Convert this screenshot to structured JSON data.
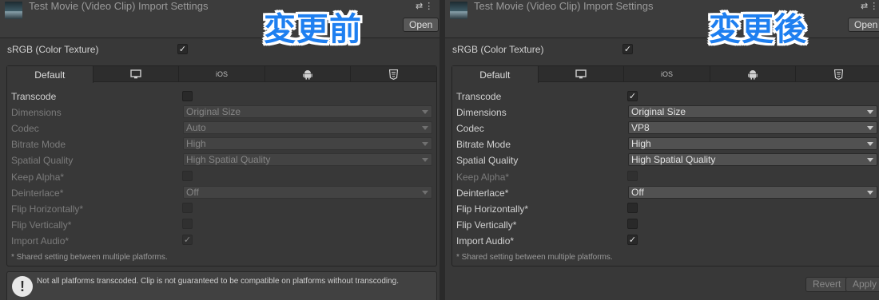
{
  "colors": {
    "stamp_blue": "#1e7ff0",
    "background": "#383838",
    "tab_bar": "#2d2d2d"
  },
  "left": {
    "window_title": "Test Movie (Video Clip) Import Settings",
    "stamp": "変更前",
    "open_label": "Open",
    "srgb_label": "sRGB (Color Texture)",
    "srgb_checked": true,
    "tabs": [
      {
        "label": "Default",
        "icon": ""
      },
      {
        "label": "",
        "icon": "monitor-icon"
      },
      {
        "label": "iOS",
        "icon": ""
      },
      {
        "label": "",
        "icon": "android-icon"
      },
      {
        "label": "",
        "icon": "html5-icon"
      }
    ],
    "rows": [
      {
        "label": "Transcode",
        "type": "check",
        "checked": false,
        "enabled": true
      },
      {
        "label": "Dimensions",
        "type": "dropdown",
        "value": "Original Size",
        "enabled": false
      },
      {
        "label": "Codec",
        "type": "dropdown",
        "value": "Auto",
        "enabled": false
      },
      {
        "label": "Bitrate Mode",
        "type": "dropdown",
        "value": "High",
        "enabled": false
      },
      {
        "label": "Spatial Quality",
        "type": "dropdown",
        "value": "High Spatial Quality",
        "enabled": false
      },
      {
        "label": "Keep Alpha*",
        "type": "check",
        "checked": false,
        "enabled": false
      },
      {
        "label": "Deinterlace*",
        "type": "dropdown",
        "value": "Off",
        "enabled": false
      },
      {
        "label": "Flip Horizontally*",
        "type": "check",
        "checked": false,
        "enabled": false
      },
      {
        "label": "Flip Vertically*",
        "type": "check",
        "checked": false,
        "enabled": false
      },
      {
        "label": "Import Audio*",
        "type": "check",
        "checked": true,
        "enabled": false
      }
    ],
    "footnote": "* Shared setting between multiple platforms.",
    "warning": "Not all platforms transcoded. Clip is not guaranteed to be compatible on platforms without transcoding."
  },
  "right": {
    "window_title": "Test Movie (Video Clip) Import Settings",
    "stamp": "変更後",
    "open_label": "Open",
    "srgb_label": "sRGB (Color Texture)",
    "srgb_checked": true,
    "tabs": [
      {
        "label": "Default",
        "icon": ""
      },
      {
        "label": "",
        "icon": "monitor-icon"
      },
      {
        "label": "iOS",
        "icon": ""
      },
      {
        "label": "",
        "icon": "android-icon"
      },
      {
        "label": "",
        "icon": "html5-icon"
      }
    ],
    "rows": [
      {
        "label": "Transcode",
        "type": "check",
        "checked": true,
        "enabled": true
      },
      {
        "label": "Dimensions",
        "type": "dropdown",
        "value": "Original Size",
        "enabled": true
      },
      {
        "label": "Codec",
        "type": "dropdown",
        "value": "VP8",
        "enabled": true
      },
      {
        "label": "Bitrate Mode",
        "type": "dropdown",
        "value": "High",
        "enabled": true
      },
      {
        "label": "Spatial Quality",
        "type": "dropdown",
        "value": "High Spatial Quality",
        "enabled": true
      },
      {
        "label": "Keep Alpha*",
        "type": "check",
        "checked": false,
        "enabled": false
      },
      {
        "label": "Deinterlace*",
        "type": "dropdown",
        "value": "Off",
        "enabled": true
      },
      {
        "label": "Flip Horizontally*",
        "type": "check",
        "checked": false,
        "enabled": true
      },
      {
        "label": "Flip Vertically*",
        "type": "check",
        "checked": false,
        "enabled": true
      },
      {
        "label": "Import Audio*",
        "type": "check",
        "checked": true,
        "enabled": true
      }
    ],
    "footnote": "* Shared setting between multiple platforms.",
    "revert_label": "Revert",
    "apply_label": "Apply"
  }
}
